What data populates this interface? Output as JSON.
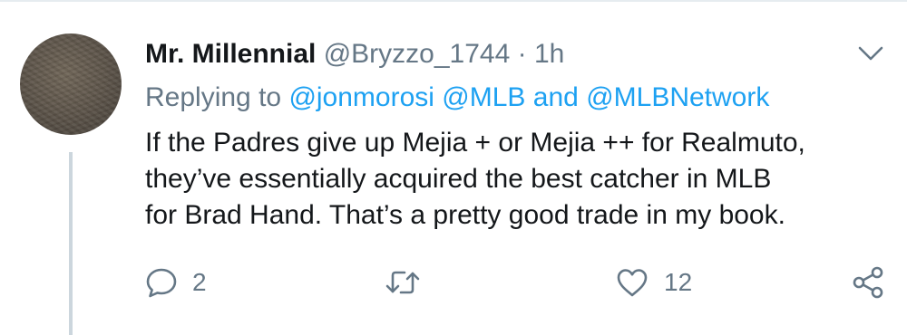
{
  "tweet": {
    "display_name": "Mr. Millennial",
    "handle": "@Bryzzo_1744",
    "separator": "·",
    "time": "1h",
    "replying_prefix": "Replying to",
    "mention_1": "@jonmorosi",
    "mention_2": "@MLB",
    "mention_and": "and",
    "mention_3": "@MLBNetwork",
    "body_lines": [
      "If the Padres give up Mejia + or Mejia ++ for Realmuto,",
      "they’ve essentially acquired the best catcher in MLB",
      "for Brad Hand. That’s a pretty good trade in my book."
    ],
    "reply_count": "2",
    "like_count": "12"
  },
  "icons": {
    "more": "chevron-down-icon",
    "reply": "reply-icon",
    "retweet": "retweet-icon",
    "like": "heart-icon",
    "share": "share-icon"
  },
  "colors": {
    "text": "#14171a",
    "secondary": "#657786",
    "link": "#1da1f2",
    "thread_line": "#ccd6dd"
  }
}
